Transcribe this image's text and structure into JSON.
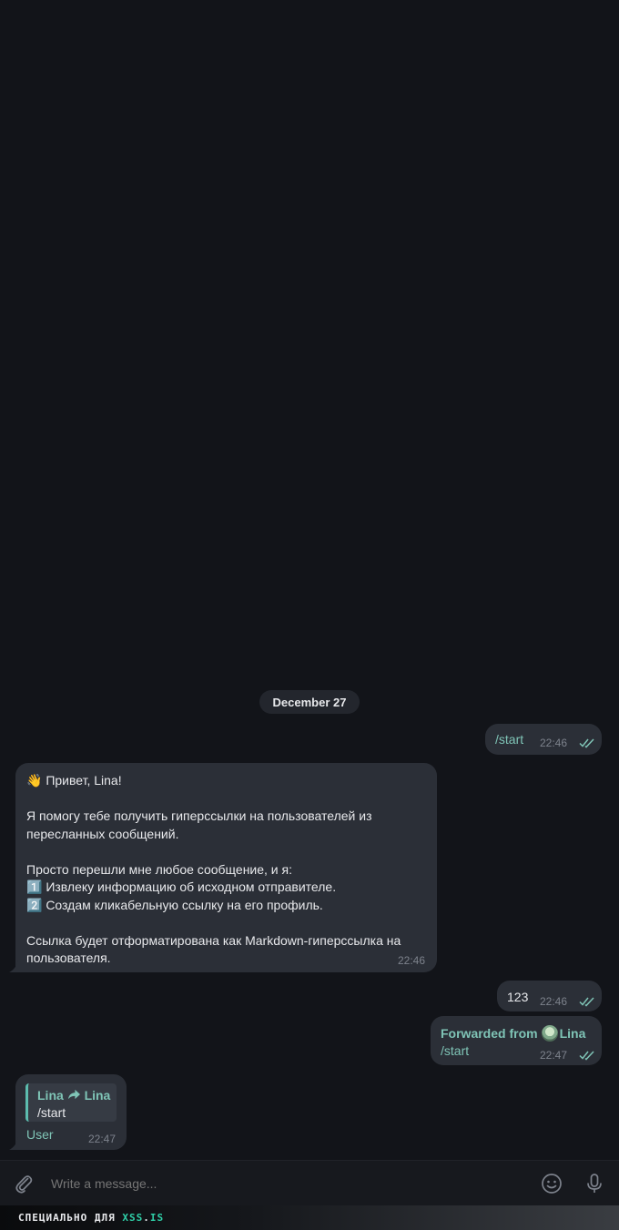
{
  "chat": {
    "date_separator": "December 27",
    "messages": [
      {
        "id": "m1",
        "direction": "out",
        "text": "/start",
        "time": "22:46",
        "status": "read"
      },
      {
        "id": "m2",
        "direction": "in",
        "lines": [
          "👋 Привет, Lina!",
          "",
          "Я помогу тебе получить гиперссылки на пользователей из",
          "пересланных сообщений.",
          "",
          "Просто перешли мне любое сообщение, и я:",
          "1️⃣ Извлеку информацию об исходном отправителе.",
          "2️⃣ Создам кликабельную ссылку на его профиль.",
          "",
          "Ссылка будет отформатирована как Markdown-гиперссылка на",
          "пользователя."
        ],
        "time": "22:46"
      },
      {
        "id": "m3",
        "direction": "out",
        "text": "123",
        "time": "22:46",
        "status": "read"
      },
      {
        "id": "m4",
        "direction": "out",
        "forwarded_label": "Forwarded from",
        "forwarded_name": "Lina",
        "text": "/start",
        "time": "22:47",
        "status": "read"
      },
      {
        "id": "m5",
        "direction": "in",
        "quote_from": "Lina",
        "quote_to": "Lina",
        "quote_text": "/start",
        "text": "User",
        "time": "22:47"
      }
    ]
  },
  "composer": {
    "placeholder": "Write a message...",
    "attach_icon": "paperclip-icon",
    "emoji_icon": "smile-icon",
    "voice_icon": "microphone-icon"
  },
  "footer": {
    "text_main": "СПЕЦИАЛЬНО ДЛЯ ",
    "text_accent_1": "XSS",
    "text_dot": ".",
    "text_accent_2": "IS"
  },
  "colors": {
    "background": "#121419",
    "bubble": "#2b2f37",
    "accent": "#7fc4b6",
    "time": "#7d828c"
  }
}
